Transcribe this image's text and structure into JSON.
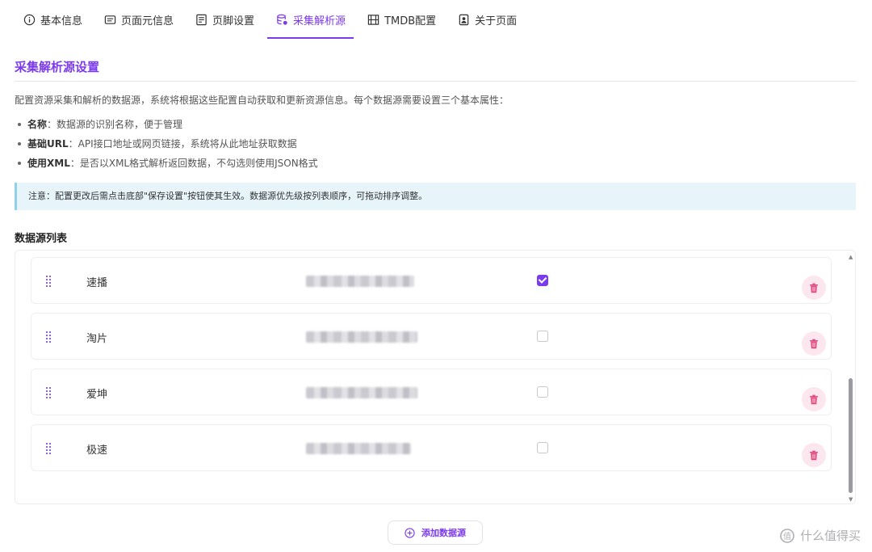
{
  "tabs": [
    {
      "label": "基本信息",
      "icon": "info-circle-icon"
    },
    {
      "label": "页面元信息",
      "icon": "list-box-icon"
    },
    {
      "label": "页脚设置",
      "icon": "footer-doc-icon"
    },
    {
      "label": "采集解析源",
      "icon": "database-icon",
      "active": true
    },
    {
      "label": "TMDB配置",
      "icon": "film-icon"
    },
    {
      "label": "关于页面",
      "icon": "profile-card-icon"
    }
  ],
  "section": {
    "title": "采集解析源设置",
    "intro": "配置资源采集和解析的数据源，系统将根据这些配置自动获取和更新资源信息。每个数据源需要设置三个基本属性："
  },
  "bullets": [
    {
      "term": "名称",
      "desc": "：数据源的识别名称，便于管理"
    },
    {
      "term": "基础URL",
      "desc": "：API接口地址或网页链接，系统将从此地址获取数据"
    },
    {
      "term": "使用XML",
      "desc": "：是否以XML格式解析返回数据，不勾选则使用JSON格式"
    }
  ],
  "notice": "注意：配置更改后需点击底部\"保存设置\"按钮使其生效。数据源优先级按列表顺序，可拖动排序调整。",
  "list_title": "数据源列表",
  "sources": [
    {
      "name": "速播",
      "use_xml": true
    },
    {
      "name": "淘片",
      "use_xml": false
    },
    {
      "name": "爱坤",
      "use_xml": false
    },
    {
      "name": "极速",
      "use_xml": false
    }
  ],
  "add_button": "添加数据源",
  "watermark": "什么值得买",
  "colors": {
    "accent": "#7c3aed",
    "notice_bg": "#e7f5fb",
    "delete_bg": "#fde7ef"
  }
}
